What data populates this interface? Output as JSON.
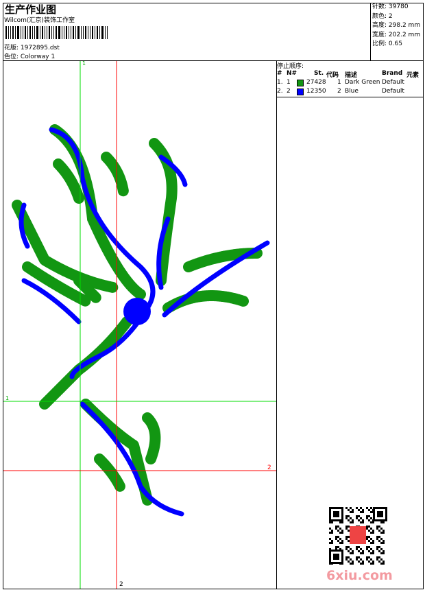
{
  "header": {
    "title": "生产作业图",
    "company": "Wilcom(汇京)装饰工作室",
    "design_file_label": "花版:",
    "design_file": "1972895.dst",
    "colorway_label": "色位:",
    "colorway": "Colorway 1"
  },
  "info": {
    "stitches_label": "针数:",
    "stitches": "39780",
    "colors_label": "颜色:",
    "colors": "2",
    "height_label": "高度:",
    "height": "298.2 mm",
    "width_label": "宽度:",
    "width": "202.2 mm",
    "scale_label": "比例:",
    "scale": "0.65"
  },
  "stop_sequence": {
    "title": "停止顺序:",
    "headers": [
      "#",
      "N#",
      "St.",
      "代码",
      "描述",
      "Brand",
      "元素"
    ],
    "rows": [
      {
        "index": "1.",
        "n": "1",
        "color": "#129612",
        "stitches": "27428",
        "code": "1",
        "description": "Dark Green",
        "brand": "Default"
      },
      {
        "index": "2.",
        "n": "2",
        "color": "#0000ff",
        "stitches": "12350",
        "code": "2",
        "description": "Blue",
        "brand": "Default"
      }
    ]
  },
  "guides": {
    "green_v": "1",
    "green_h": "1",
    "red_h": "2",
    "red_v": "2",
    "green_color": "#00dd00",
    "red_color": "#ff0000"
  },
  "watermark": "6xiu.com"
}
